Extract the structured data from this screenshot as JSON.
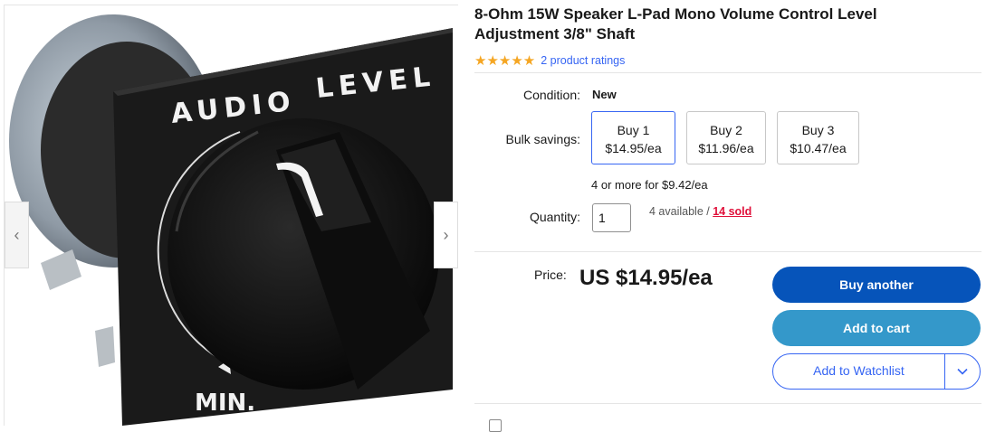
{
  "gallery": {
    "image_label_audio": "AUDIO",
    "image_label_level": "LEVEL",
    "image_label_min": "MIN.",
    "prev_icon": "chevron-left-icon",
    "next_icon": "chevron-right-icon"
  },
  "product": {
    "title": "8-Ohm 15W Speaker L-Pad Mono Volume Control Level Adjustment 3/8\" Shaft",
    "stars": "★★★★★",
    "ratings_link": "2 product ratings"
  },
  "condition": {
    "label": "Condition:",
    "value": "New"
  },
  "bulk": {
    "label": "Bulk savings:",
    "options": [
      {
        "qty": "Buy 1",
        "price": "$14.95/ea",
        "selected": true
      },
      {
        "qty": "Buy 2",
        "price": "$11.96/ea",
        "selected": false
      },
      {
        "qty": "Buy 3",
        "price": "$10.47/ea",
        "selected": false
      }
    ],
    "note": "4 or more for $9.42/ea"
  },
  "quantity": {
    "label": "Quantity:",
    "value": "1",
    "available": "4 available / ",
    "sold": "14 sold"
  },
  "price": {
    "label": "Price:",
    "value": "US $14.95/ea"
  },
  "buttons": {
    "buy_another": "Buy another",
    "add_to_cart": "Add to cart",
    "watchlist": "Add to Watchlist"
  },
  "colors": {
    "primary": "#0654ba",
    "cart": "#3498ca",
    "link": "#3665f3",
    "sold": "#e0103a",
    "stars": "#f5a623"
  }
}
